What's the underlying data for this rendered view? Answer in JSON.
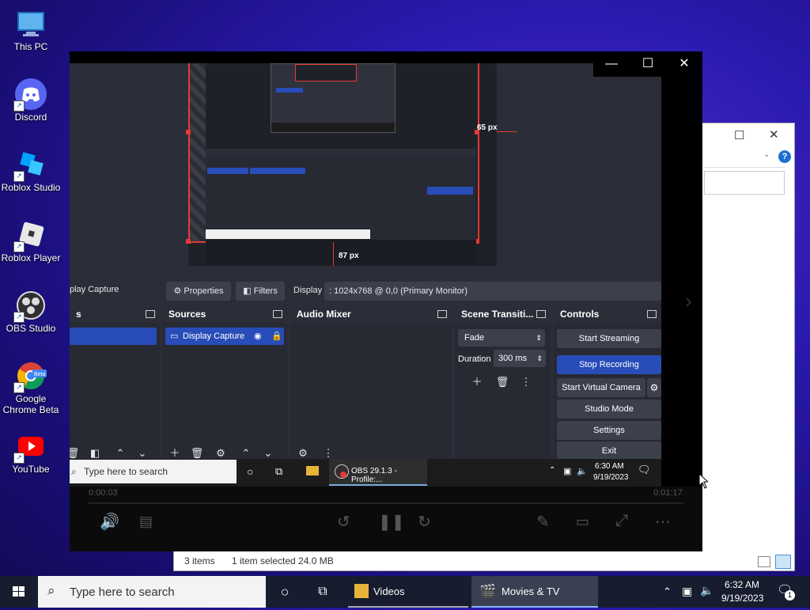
{
  "desktop": {
    "icons": [
      {
        "label": "This PC",
        "icon": "this-pc-icon"
      },
      {
        "label": "Discord",
        "icon": "discord-icon"
      },
      {
        "label": "Roblox Studio",
        "icon": "roblox-studio-icon"
      },
      {
        "label": "Roblox Player",
        "icon": "roblox-player-icon"
      },
      {
        "label": "OBS Studio",
        "icon": "obs-icon"
      },
      {
        "label": "Google Chrome Beta",
        "icon": "chrome-beta-icon"
      },
      {
        "label": "YouTube",
        "icon": "youtube-icon"
      }
    ]
  },
  "explorer": {
    "status_items": "3 items",
    "status_selected": "1 item selected  24.0 MB"
  },
  "player": {
    "obs": {
      "ruler_right": "65 px",
      "ruler_bottom": "87 px",
      "source_name": "play Capture",
      "properties_label": "Properties",
      "filters_label": "Filters",
      "display_label": "Display",
      "display_value": ": 1024x768 @ 0,0 (Primary Monitor)",
      "docks": {
        "scenes_title": "s",
        "sources_title": "Sources",
        "source_item": "Display Capture",
        "mixer_title": "Audio Mixer",
        "transitions_title": "Scene Transiti...",
        "transition_value": "Fade",
        "duration_label": "Duration",
        "duration_value": "300 ms",
        "controls_title": "Controls"
      },
      "controls": {
        "start_streaming": "Start Streaming",
        "stop_recording": "Stop Recording",
        "start_virtual_camera": "Start Virtual Camera",
        "studio_mode": "Studio Mode",
        "settings": "Settings",
        "exit": "Exit"
      },
      "inner_taskbar": {
        "search_placeholder": "Type here to search",
        "obs_item": "OBS 29.1.3 - Profile:...",
        "time": "6:30 AM",
        "date": "9/19/2023"
      }
    },
    "time_elapsed": "0:00:03",
    "time_remaining": "0:01:17"
  },
  "taskbar": {
    "search_placeholder": "Type here to search",
    "apps": [
      {
        "label": "Videos",
        "icon": "videos-folder-icon"
      },
      {
        "label": "Movies & TV",
        "icon": "movies-tv-icon"
      }
    ],
    "time": "6:32 AM",
    "date": "9/19/2023",
    "notification_count": "1"
  },
  "colors": {
    "obs_accent": "#284cb8",
    "obs_bg": "#272a33",
    "record_red": "#e53935",
    "desktop_bg": "#2b1ab0"
  }
}
